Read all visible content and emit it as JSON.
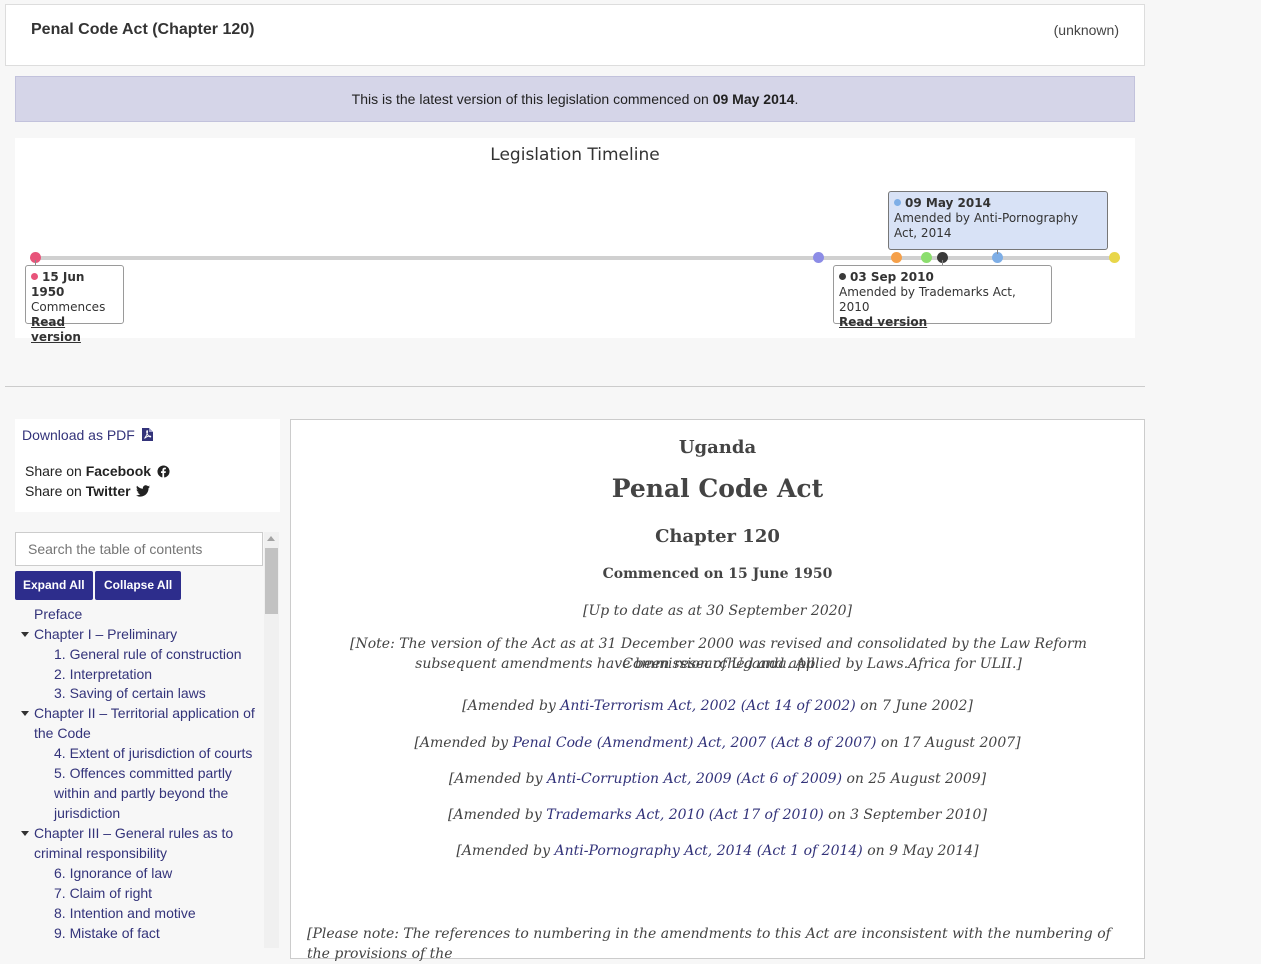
{
  "header": {
    "title": "Penal Code Act (Chapter 120)",
    "status": "(unknown)"
  },
  "banner": {
    "prefix": "This is the latest version of this legislation commenced on ",
    "date": "09 May 2014",
    "suffix": "."
  },
  "timeline": {
    "title": "Legislation Timeline",
    "cards": [
      {
        "date": "15 Jun 1950",
        "desc": "Commences",
        "link": "Read version"
      },
      {
        "date": "09 May 2014",
        "desc": "Amended by Anti-Pornography Act, 2014"
      },
      {
        "date": "03 Sep 2010",
        "desc": "Amended by Trademarks Act, 2010",
        "link": "Read version"
      }
    ],
    "colors": {
      "pink": "#e8547a",
      "purple": "#8c8ce6",
      "orange": "#f5a04a",
      "green": "#8cde6e",
      "dark": "#3a3a3a",
      "blue": "#7eaee6",
      "yellow": "#e8d64a"
    }
  },
  "sidebar": {
    "download_label": "Download as PDF",
    "share_prefix": "Share on ",
    "facebook": "Facebook",
    "twitter": "Twitter",
    "search_placeholder": "Search the table of contents",
    "expand_all": "Expand All",
    "collapse_all": "Collapse All",
    "toc": [
      "Preface",
      "Chapter I – Preliminary",
      "1. General rule of construction",
      "2. Interpretation",
      "3. Saving of certain laws",
      "Chapter II – Territorial application of",
      "the Code",
      "4. Extent of jurisdiction of courts",
      "5. Offences committed partly",
      "within and partly beyond the",
      "jurisdiction",
      "Chapter III – General rules as to",
      "criminal responsibility",
      "6. Ignorance of law",
      "7. Claim of right",
      "8. Intention and motive",
      "9. Mistake of fact"
    ]
  },
  "document": {
    "country": "Uganda",
    "title": "Penal Code Act",
    "chapter": "Chapter 120",
    "commenced": "Commenced on 15 June 1950",
    "up_to_date": "[Up to date as at 30 September 2020]",
    "note_line1": "[Note: The version of the Act as at 31 December 2000 was revised and consolidated by the Law Reform Commission of Uganda. All",
    "note_line2": "subsequent amendments have been researched and applied by Laws.Africa for ULII.]",
    "amendments": [
      {
        "pre": "[Amended by ",
        "link": "Anti-Terrorism Act, 2002 (Act 14 of 2002)",
        "post": " on 7 June 2002]"
      },
      {
        "pre": "[Amended by ",
        "link": "Penal Code (Amendment) Act, 2007 (Act 8 of 2007)",
        "post": " on 17 August 2007]"
      },
      {
        "pre": "[Amended by ",
        "link": "Anti-Corruption Act, 2009 (Act 6 of 2009)",
        "post": " on 25 August 2009]"
      },
      {
        "pre": "[Amended by ",
        "link": "Trademarks Act, 2010 (Act 17 of 2010)",
        "post": " on 3 September 2010]"
      },
      {
        "pre": "[Amended by ",
        "link": "Anti-Pornography Act, 2014 (Act 1 of 2014)",
        "post": " on 9 May 2014]"
      }
    ],
    "please_note": "[Please note: The references to numbering in the amendments to this Act are inconsistent with the numbering of the provisions of the"
  }
}
